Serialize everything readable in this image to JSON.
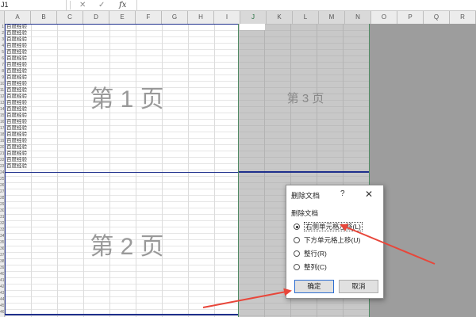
{
  "formula_bar": {
    "name_box": "J1",
    "cancel_symbol": "✕",
    "enter_symbol": "✓",
    "fx_label": "fx"
  },
  "columns": [
    "A",
    "B",
    "C",
    "D",
    "E",
    "F",
    "G",
    "H",
    "I",
    "J",
    "K",
    "L",
    "M",
    "N",
    "O",
    "P",
    "Q",
    "R"
  ],
  "rows": [
    "1",
    "2",
    "3",
    "4",
    "5",
    "6",
    "7",
    "8",
    "9",
    "10",
    "11",
    "12",
    "13",
    "14",
    "15",
    "16",
    "17",
    "18",
    "19",
    "20",
    "21",
    "22",
    "23",
    "24",
    "25",
    "26",
    "27",
    "28",
    "29",
    "30",
    "31",
    "32",
    "33",
    "34",
    "35",
    "36",
    "37",
    "38",
    "39",
    "40",
    "41",
    "42",
    "43",
    "44",
    "45",
    "46"
  ],
  "column_a_values": [
    "百度经验",
    "百度经验",
    "百度经验",
    "百度经验",
    "百度经验",
    "百度经验",
    "百度经验",
    "百度经验",
    "百度经验",
    "百度经验",
    "百度经验",
    "百度经验",
    "百度经验",
    "百度经验",
    "百度经验",
    "百度经验",
    "百度经验",
    "百度经验",
    "百度经验",
    "百度经验",
    "百度经验",
    "百度经验",
    "百度经验"
  ],
  "page_labels": {
    "page1": "第 1 页",
    "page2": "第 2 页",
    "page3": "第 3 页"
  },
  "dialog": {
    "title": "删除文档",
    "help": "?",
    "close": "✕",
    "section_label": "删除文档",
    "options": [
      {
        "label": "右侧单元格左移(L)",
        "selected": true
      },
      {
        "label": "下方单元格上移(U)",
        "selected": false
      },
      {
        "label": "整行(R)",
        "selected": false
      },
      {
        "label": "整列(C)",
        "selected": false
      }
    ],
    "ok_label": "确定",
    "cancel_label": "取消"
  },
  "colors": {
    "page_break": "#1e2f8c",
    "annotation_arrow": "#e8463a",
    "print_area_border": "#4f8a63"
  }
}
